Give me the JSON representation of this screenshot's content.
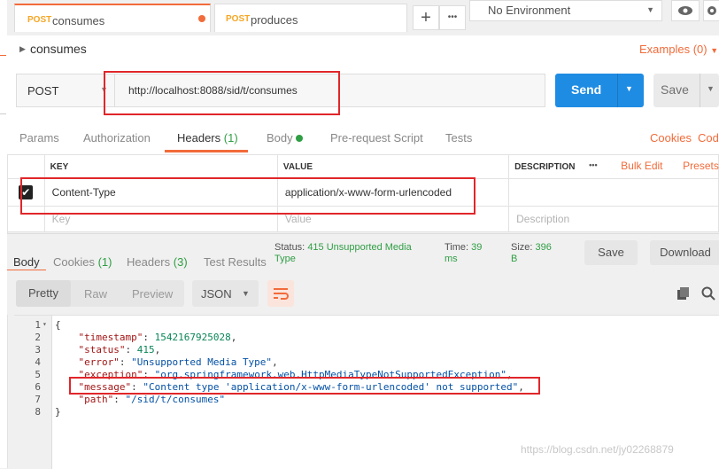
{
  "tabs": [
    {
      "method": "POST",
      "name": "consumes"
    },
    {
      "method": "POST",
      "name": "produces"
    }
  ],
  "environment": "No Environment",
  "request": {
    "title": "consumes",
    "examples": "Examples (0)",
    "method": "POST",
    "url": "http://localhost:8088/sid/t/consumes",
    "send_label": "Send",
    "save_label": "Save"
  },
  "request_tabs": {
    "params": "Params",
    "authorization": "Authorization",
    "headers": "Headers",
    "headers_count": "(1)",
    "body": "Body",
    "prerequest": "Pre-request Script",
    "tests": "Tests",
    "cookies": "Cookies",
    "code": "Code"
  },
  "headers_table": {
    "col_key": "KEY",
    "col_value": "VALUE",
    "col_description": "DESCRIPTION",
    "more": "•••",
    "bulk_edit": "Bulk Edit",
    "presets": "Presets",
    "rows": [
      {
        "key": "Content-Type",
        "value": "application/x-www-form-urlencoded",
        "checked": true
      }
    ],
    "placeholder_key": "Key",
    "placeholder_value": "Value",
    "placeholder_description": "Description"
  },
  "response_tabs": {
    "body": "Body",
    "cookies": "Cookies",
    "cookies_count": "(1)",
    "headers": "Headers",
    "headers_count": "(3)",
    "test_results": "Test Results"
  },
  "response_meta": {
    "status_label": "Status:",
    "status_value_l1": "415 Unsupported Media",
    "status_value_l2": "Type",
    "time_label": "Time:",
    "time_value_l1": "39",
    "time_value_l2": "ms",
    "size_label": "Size:",
    "size_value_l1": "396",
    "size_value_l2": "B",
    "save": "Save",
    "download": "Download"
  },
  "view": {
    "pretty": "Pretty",
    "raw": "Raw",
    "preview": "Preview",
    "format": "JSON"
  },
  "code": {
    "line_numbers": [
      "1",
      "2",
      "3",
      "4",
      "5",
      "6",
      "7",
      "8"
    ],
    "l1": "{",
    "l2k": "\"timestamp\"",
    "l2v": "1542167925028",
    "l3k": "\"status\"",
    "l3v": "415",
    "l4k": "\"error\"",
    "l4v": "\"Unsupported Media Type\"",
    "l5k": "\"exception\"",
    "l5v": "\"org.springframework.web.HttpMediaTypeNotSupportedException\"",
    "l6k": "\"message\"",
    "l6v": "\"Content type 'application/x-www-form-urlencoded' not supported\"",
    "l7k": "\"path\"",
    "l7v": "\"/sid/t/consumes\"",
    "l8": "}"
  },
  "watermark": "https://blog.csdn.net/jy02268879",
  "colors": {
    "accent": "#f26b3a",
    "send": "#1f8ce3",
    "status_green": "#2f9e44",
    "highlight_red": "#e0262a"
  }
}
